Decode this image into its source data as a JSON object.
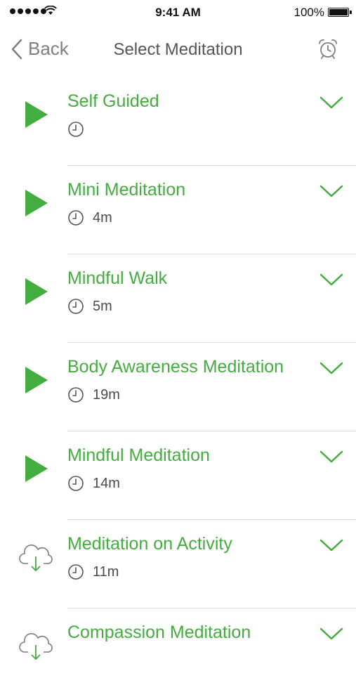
{
  "status_bar": {
    "time": "9:41 AM",
    "battery": "100%"
  },
  "nav": {
    "back_label": "Back",
    "title": "Select Meditation"
  },
  "colors": {
    "accent": "#44ad3f",
    "text": "#4a4a4a",
    "divider": "#dcdcdc"
  },
  "meditations": [
    {
      "title": "Self Guided",
      "duration": "",
      "icon": "play-icon"
    },
    {
      "title": "Mini Meditation",
      "duration": "4m",
      "icon": "play-icon"
    },
    {
      "title": "Mindful Walk",
      "duration": "5m",
      "icon": "play-icon"
    },
    {
      "title": "Body Awareness Meditation",
      "duration": "19m",
      "icon": "play-icon"
    },
    {
      "title": "Mindful Meditation",
      "duration": "14m",
      "icon": "play-icon"
    },
    {
      "title": "Meditation on Activity",
      "duration": "11m",
      "icon": "cloud-download-icon"
    },
    {
      "title": "Compassion Meditation",
      "duration": "",
      "icon": "cloud-download-icon"
    }
  ]
}
